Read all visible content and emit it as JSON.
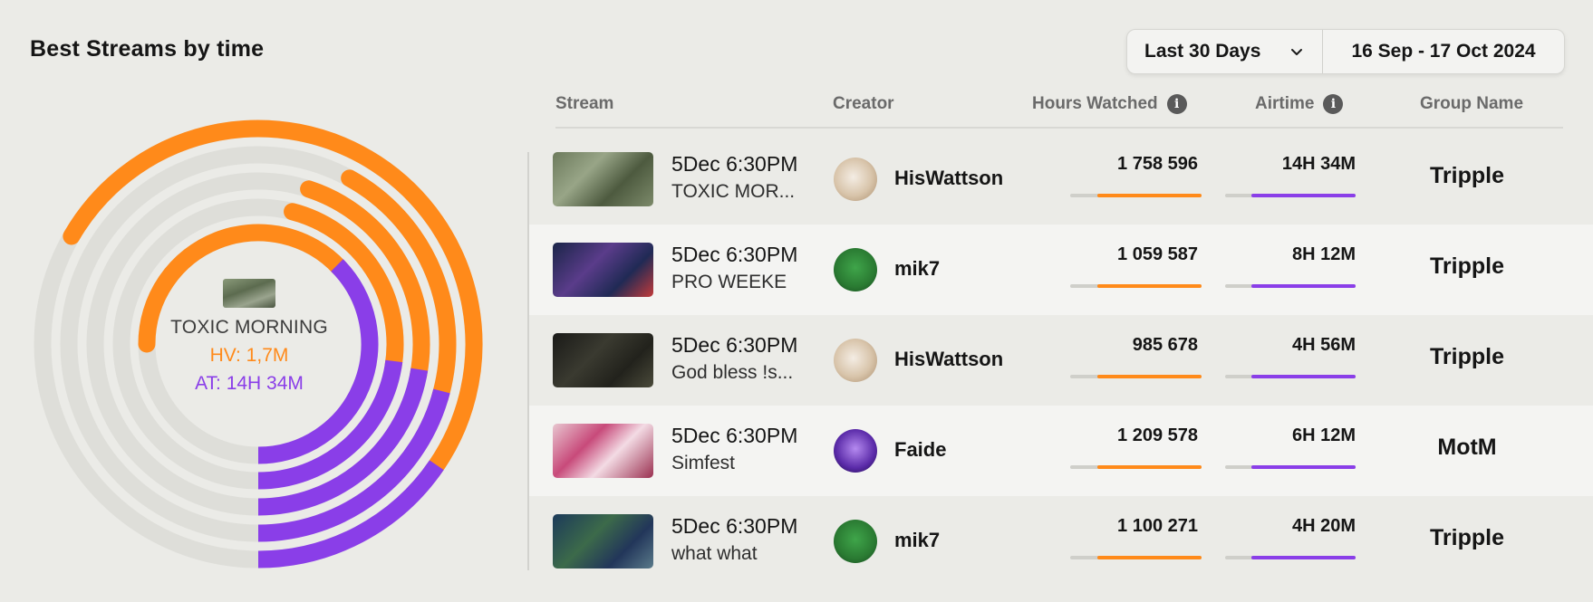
{
  "header": {
    "title": "Best Streams by time"
  },
  "range": {
    "selected": "Last 30 Days",
    "dates": "16 Sep - 17 Oct 2024"
  },
  "colors": {
    "hours": "#ff8a1a",
    "airtime": "#8a3ee8",
    "track": "#deded9"
  },
  "donut": {
    "highlight": {
      "name": "TOXIC MORNING",
      "hv": "HV: 1,7M",
      "at": "AT: 14H 34M"
    },
    "rings": [
      {
        "hours_fraction": 0.75,
        "airtime_fraction": 0.75
      },
      {
        "hours_fraction": 0.46,
        "airtime_fraction": 0.46
      },
      {
        "hours_fraction": 0.45,
        "airtime_fraction": 0.45
      },
      {
        "hours_fraction": 0.42,
        "airtime_fraction": 0.42
      },
      {
        "hours_fraction": 0.69,
        "airtime_fraction": 0.31
      }
    ]
  },
  "table": {
    "headers": {
      "stream": "Stream",
      "creator": "Creator",
      "hours": "Hours Watched",
      "airtime": "Airtime",
      "group": "Group Name"
    },
    "rows": [
      {
        "date": "5Dec 6:30PM",
        "title": "TOXIC MOR...",
        "thumb": "thumb-a",
        "avatar": "av-cat",
        "avatar_icon": "cat-avatar",
        "creator": "HisWattson",
        "hours": "1 758 596",
        "hours_fraction": 0.79,
        "airtime": "14H 34M",
        "airtime_fraction": 0.8,
        "group": "Tripple"
      },
      {
        "date": "5Dec 6:30PM",
        "title": "PRO WEEKE",
        "thumb": "thumb-b",
        "avatar": "av-pepe",
        "avatar_icon": "frog-avatar",
        "creator": "mik7",
        "hours": "1 059 587",
        "hours_fraction": 0.79,
        "airtime": "8H 12M",
        "airtime_fraction": 0.8,
        "group": "Tripple"
      },
      {
        "date": "5Dec 6:30PM",
        "title": "God bless !s...",
        "thumb": "thumb-c",
        "avatar": "av-cat",
        "avatar_icon": "cat-avatar",
        "creator": "HisWattson",
        "hours": "985 678",
        "hours_fraction": 0.79,
        "airtime": "4H 56M",
        "airtime_fraction": 0.8,
        "group": "Tripple"
      },
      {
        "date": "5Dec 6:30PM",
        "title": "Simfest",
        "thumb": "thumb-d",
        "avatar": "av-faide",
        "avatar_icon": "faide-avatar",
        "creator": "Faide",
        "hours": "1 209 578",
        "hours_fraction": 0.79,
        "airtime": "6H 12M",
        "airtime_fraction": 0.8,
        "group": "MotM"
      },
      {
        "date": "5Dec 6:30PM",
        "title": "what what",
        "thumb": "thumb-e",
        "avatar": "av-pepe",
        "avatar_icon": "frog-avatar",
        "creator": "mik7",
        "hours": "1 100 271",
        "hours_fraction": 0.79,
        "airtime": "4H 20M",
        "airtime_fraction": 0.8,
        "group": "Tripple"
      }
    ]
  }
}
